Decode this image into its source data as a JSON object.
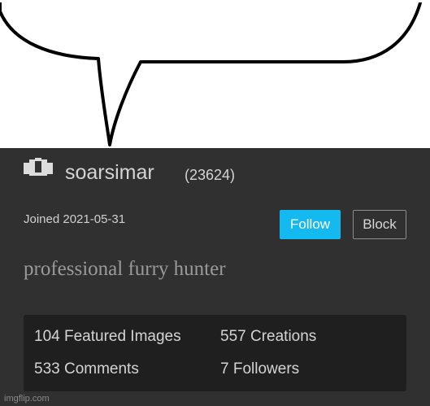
{
  "profile": {
    "username": "soarsimar",
    "points": "(23624)",
    "joined": "Joined 2021-05-31",
    "follow_label": "Follow",
    "block_label": "Block",
    "bio": "professional furry hunter",
    "stats": {
      "featured_images": "104 Featured Images",
      "creations": "557 Creations",
      "comments": "533 Comments",
      "followers": "7 Followers"
    }
  },
  "watermark": "imgflip.com",
  "colors": {
    "panel_background": "#303030",
    "stats_background": "#1f1f1f",
    "follow_button": "#14b9f0",
    "bio_text": "#9a9a9a"
  },
  "icons": {
    "avatar": "pixel-avatar-icon"
  }
}
